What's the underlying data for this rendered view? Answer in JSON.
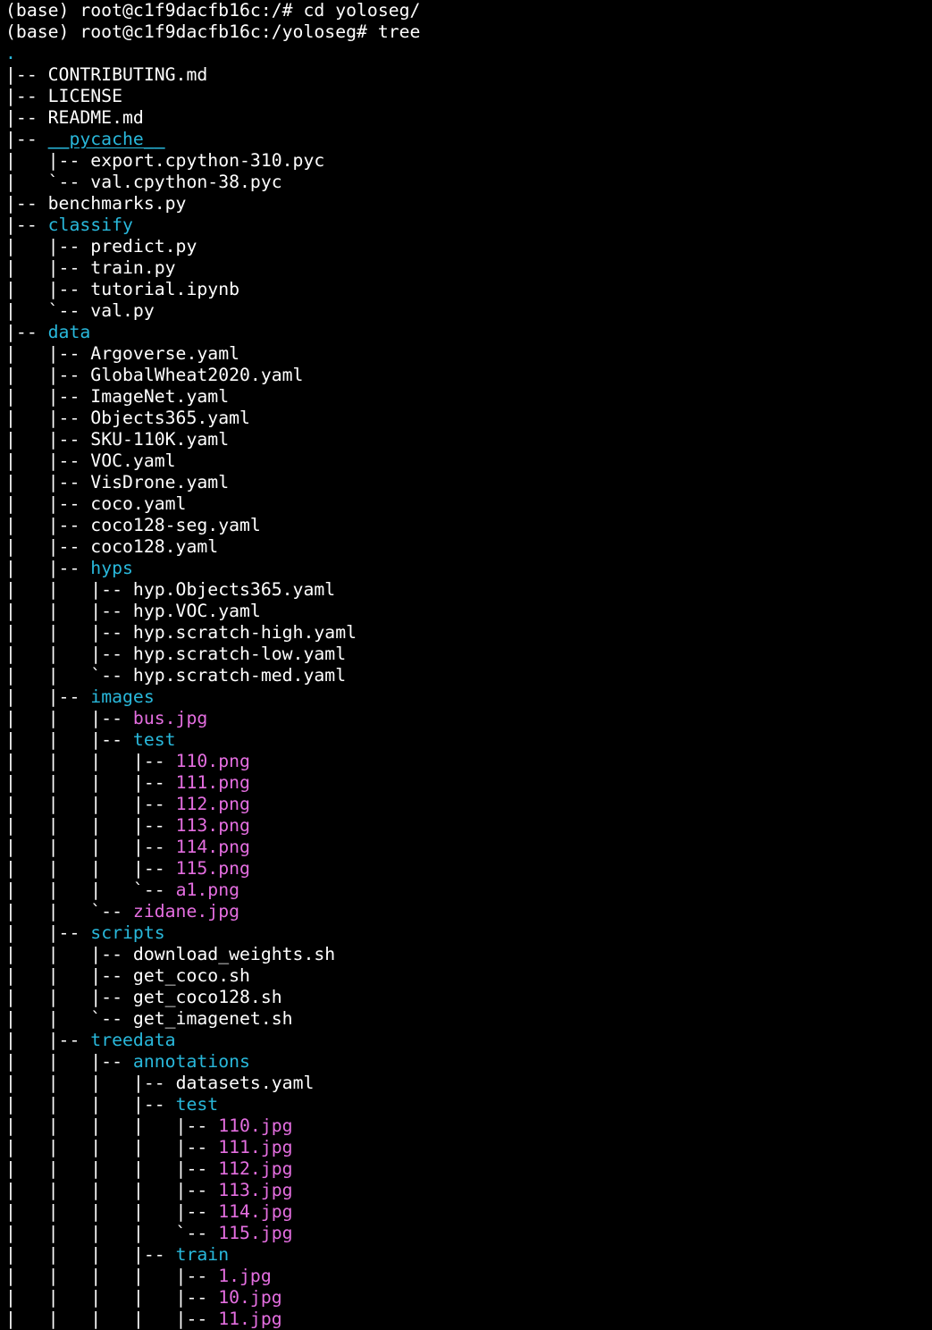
{
  "terminal": {
    "colors": {
      "background": "#000000",
      "text": "#ffffff",
      "directory": "#29b8db",
      "image_file": "#e46ee0"
    },
    "lines": [
      {
        "kind": "prompt",
        "segments": [
          {
            "t": "(base) root@c1f9dacfb16c:/# cd yoloseg/",
            "s": "plain"
          }
        ]
      },
      {
        "kind": "prompt",
        "segments": [
          {
            "t": "(base) root@c1f9dacfb16c:/yoloseg# tree",
            "s": "plain"
          }
        ]
      },
      {
        "kind": "tree",
        "segments": [
          {
            "t": ".",
            "s": "dot"
          }
        ]
      },
      {
        "kind": "tree",
        "segments": [
          {
            "t": "|-- ",
            "s": "plain"
          },
          {
            "t": "CONTRIBUTING.md",
            "s": "plain"
          }
        ]
      },
      {
        "kind": "tree",
        "segments": [
          {
            "t": "|-- ",
            "s": "plain"
          },
          {
            "t": "LICENSE",
            "s": "plain"
          }
        ]
      },
      {
        "kind": "tree",
        "segments": [
          {
            "t": "|-- ",
            "s": "plain"
          },
          {
            "t": "README.md",
            "s": "plain"
          }
        ]
      },
      {
        "kind": "tree",
        "segments": [
          {
            "t": "|-- ",
            "s": "plain"
          },
          {
            "t": "__pycache__",
            "s": "under"
          }
        ]
      },
      {
        "kind": "tree",
        "segments": [
          {
            "t": "|   |-- ",
            "s": "plain"
          },
          {
            "t": "export.cpython-310.pyc",
            "s": "plain"
          }
        ]
      },
      {
        "kind": "tree",
        "segments": [
          {
            "t": "|   `-- ",
            "s": "plain"
          },
          {
            "t": "val.cpython-38.pyc",
            "s": "plain"
          }
        ]
      },
      {
        "kind": "tree",
        "segments": [
          {
            "t": "|-- ",
            "s": "plain"
          },
          {
            "t": "benchmarks.py",
            "s": "plain"
          }
        ]
      },
      {
        "kind": "tree",
        "segments": [
          {
            "t": "|-- ",
            "s": "plain"
          },
          {
            "t": "classify",
            "s": "dir"
          }
        ]
      },
      {
        "kind": "tree",
        "segments": [
          {
            "t": "|   |-- ",
            "s": "plain"
          },
          {
            "t": "predict.py",
            "s": "plain"
          }
        ]
      },
      {
        "kind": "tree",
        "segments": [
          {
            "t": "|   |-- ",
            "s": "plain"
          },
          {
            "t": "train.py",
            "s": "plain"
          }
        ]
      },
      {
        "kind": "tree",
        "segments": [
          {
            "t": "|   |-- ",
            "s": "plain"
          },
          {
            "t": "tutorial.ipynb",
            "s": "plain"
          }
        ]
      },
      {
        "kind": "tree",
        "segments": [
          {
            "t": "|   `-- ",
            "s": "plain"
          },
          {
            "t": "val.py",
            "s": "plain"
          }
        ]
      },
      {
        "kind": "tree",
        "segments": [
          {
            "t": "|-- ",
            "s": "plain"
          },
          {
            "t": "data",
            "s": "dir"
          }
        ]
      },
      {
        "kind": "tree",
        "segments": [
          {
            "t": "|   |-- ",
            "s": "plain"
          },
          {
            "t": "Argoverse.yaml",
            "s": "plain"
          }
        ]
      },
      {
        "kind": "tree",
        "segments": [
          {
            "t": "|   |-- ",
            "s": "plain"
          },
          {
            "t": "GlobalWheat2020.yaml",
            "s": "plain"
          }
        ]
      },
      {
        "kind": "tree",
        "segments": [
          {
            "t": "|   |-- ",
            "s": "plain"
          },
          {
            "t": "ImageNet.yaml",
            "s": "plain"
          }
        ]
      },
      {
        "kind": "tree",
        "segments": [
          {
            "t": "|   |-- ",
            "s": "plain"
          },
          {
            "t": "Objects365.yaml",
            "s": "plain"
          }
        ]
      },
      {
        "kind": "tree",
        "segments": [
          {
            "t": "|   |-- ",
            "s": "plain"
          },
          {
            "t": "SKU-110K.yaml",
            "s": "plain"
          }
        ]
      },
      {
        "kind": "tree",
        "segments": [
          {
            "t": "|   |-- ",
            "s": "plain"
          },
          {
            "t": "VOC.yaml",
            "s": "plain"
          }
        ]
      },
      {
        "kind": "tree",
        "segments": [
          {
            "t": "|   |-- ",
            "s": "plain"
          },
          {
            "t": "VisDrone.yaml",
            "s": "plain"
          }
        ]
      },
      {
        "kind": "tree",
        "segments": [
          {
            "t": "|   |-- ",
            "s": "plain"
          },
          {
            "t": "coco.yaml",
            "s": "plain"
          }
        ]
      },
      {
        "kind": "tree",
        "segments": [
          {
            "t": "|   |-- ",
            "s": "plain"
          },
          {
            "t": "coco128-seg.yaml",
            "s": "plain"
          }
        ]
      },
      {
        "kind": "tree",
        "segments": [
          {
            "t": "|   |-- ",
            "s": "plain"
          },
          {
            "t": "coco128.yaml",
            "s": "plain"
          }
        ]
      },
      {
        "kind": "tree",
        "segments": [
          {
            "t": "|   |-- ",
            "s": "plain"
          },
          {
            "t": "hyps",
            "s": "dir"
          }
        ]
      },
      {
        "kind": "tree",
        "segments": [
          {
            "t": "|   |   |-- ",
            "s": "plain"
          },
          {
            "t": "hyp.Objects365.yaml",
            "s": "plain"
          }
        ]
      },
      {
        "kind": "tree",
        "segments": [
          {
            "t": "|   |   |-- ",
            "s": "plain"
          },
          {
            "t": "hyp.VOC.yaml",
            "s": "plain"
          }
        ]
      },
      {
        "kind": "tree",
        "segments": [
          {
            "t": "|   |   |-- ",
            "s": "plain"
          },
          {
            "t": "hyp.scratch-high.yaml",
            "s": "plain"
          }
        ]
      },
      {
        "kind": "tree",
        "segments": [
          {
            "t": "|   |   |-- ",
            "s": "plain"
          },
          {
            "t": "hyp.scratch-low.yaml",
            "s": "plain"
          }
        ]
      },
      {
        "kind": "tree",
        "segments": [
          {
            "t": "|   |   `-- ",
            "s": "plain"
          },
          {
            "t": "hyp.scratch-med.yaml",
            "s": "plain"
          }
        ]
      },
      {
        "kind": "tree",
        "segments": [
          {
            "t": "|   |-- ",
            "s": "plain"
          },
          {
            "t": "images",
            "s": "dir"
          }
        ]
      },
      {
        "kind": "tree",
        "segments": [
          {
            "t": "|   |   |-- ",
            "s": "plain"
          },
          {
            "t": "bus.jpg",
            "s": "img"
          }
        ]
      },
      {
        "kind": "tree",
        "segments": [
          {
            "t": "|   |   |-- ",
            "s": "plain"
          },
          {
            "t": "test",
            "s": "dir"
          }
        ]
      },
      {
        "kind": "tree",
        "segments": [
          {
            "t": "|   |   |   |-- ",
            "s": "plain"
          },
          {
            "t": "110.png",
            "s": "img"
          }
        ]
      },
      {
        "kind": "tree",
        "segments": [
          {
            "t": "|   |   |   |-- ",
            "s": "plain"
          },
          {
            "t": "111.png",
            "s": "img"
          }
        ]
      },
      {
        "kind": "tree",
        "segments": [
          {
            "t": "|   |   |   |-- ",
            "s": "plain"
          },
          {
            "t": "112.png",
            "s": "img"
          }
        ]
      },
      {
        "kind": "tree",
        "segments": [
          {
            "t": "|   |   |   |-- ",
            "s": "plain"
          },
          {
            "t": "113.png",
            "s": "img"
          }
        ]
      },
      {
        "kind": "tree",
        "segments": [
          {
            "t": "|   |   |   |-- ",
            "s": "plain"
          },
          {
            "t": "114.png",
            "s": "img"
          }
        ]
      },
      {
        "kind": "tree",
        "segments": [
          {
            "t": "|   |   |   |-- ",
            "s": "plain"
          },
          {
            "t": "115.png",
            "s": "img"
          }
        ]
      },
      {
        "kind": "tree",
        "segments": [
          {
            "t": "|   |   |   `-- ",
            "s": "plain"
          },
          {
            "t": "a1.png",
            "s": "img"
          }
        ]
      },
      {
        "kind": "tree",
        "segments": [
          {
            "t": "|   |   `-- ",
            "s": "plain"
          },
          {
            "t": "zidane.jpg",
            "s": "img"
          }
        ]
      },
      {
        "kind": "tree",
        "segments": [
          {
            "t": "|   |-- ",
            "s": "plain"
          },
          {
            "t": "scripts",
            "s": "dir"
          }
        ]
      },
      {
        "kind": "tree",
        "segments": [
          {
            "t": "|   |   |-- ",
            "s": "plain"
          },
          {
            "t": "download_weights.sh",
            "s": "plain"
          }
        ]
      },
      {
        "kind": "tree",
        "segments": [
          {
            "t": "|   |   |-- ",
            "s": "plain"
          },
          {
            "t": "get_coco.sh",
            "s": "plain"
          }
        ]
      },
      {
        "kind": "tree",
        "segments": [
          {
            "t": "|   |   |-- ",
            "s": "plain"
          },
          {
            "t": "get_coco128.sh",
            "s": "plain"
          }
        ]
      },
      {
        "kind": "tree",
        "segments": [
          {
            "t": "|   |   `-- ",
            "s": "plain"
          },
          {
            "t": "get_imagenet.sh",
            "s": "plain"
          }
        ]
      },
      {
        "kind": "tree",
        "segments": [
          {
            "t": "|   |-- ",
            "s": "plain"
          },
          {
            "t": "treedata",
            "s": "dir"
          }
        ]
      },
      {
        "kind": "tree",
        "segments": [
          {
            "t": "|   |   |-- ",
            "s": "plain"
          },
          {
            "t": "annotations",
            "s": "dir"
          }
        ]
      },
      {
        "kind": "tree",
        "segments": [
          {
            "t": "|   |   |   |-- ",
            "s": "plain"
          },
          {
            "t": "datasets.yaml",
            "s": "plain"
          }
        ]
      },
      {
        "kind": "tree",
        "segments": [
          {
            "t": "|   |   |   |-- ",
            "s": "plain"
          },
          {
            "t": "test",
            "s": "dir"
          }
        ]
      },
      {
        "kind": "tree",
        "segments": [
          {
            "t": "|   |   |   |   |-- ",
            "s": "plain"
          },
          {
            "t": "110.jpg",
            "s": "img"
          }
        ]
      },
      {
        "kind": "tree",
        "segments": [
          {
            "t": "|   |   |   |   |-- ",
            "s": "plain"
          },
          {
            "t": "111.jpg",
            "s": "img"
          }
        ]
      },
      {
        "kind": "tree",
        "segments": [
          {
            "t": "|   |   |   |   |-- ",
            "s": "plain"
          },
          {
            "t": "112.jpg",
            "s": "img"
          }
        ]
      },
      {
        "kind": "tree",
        "segments": [
          {
            "t": "|   |   |   |   |-- ",
            "s": "plain"
          },
          {
            "t": "113.jpg",
            "s": "img"
          }
        ]
      },
      {
        "kind": "tree",
        "segments": [
          {
            "t": "|   |   |   |   |-- ",
            "s": "plain"
          },
          {
            "t": "114.jpg",
            "s": "img"
          }
        ]
      },
      {
        "kind": "tree",
        "segments": [
          {
            "t": "|   |   |   |   `-- ",
            "s": "plain"
          },
          {
            "t": "115.jpg",
            "s": "img"
          }
        ]
      },
      {
        "kind": "tree",
        "segments": [
          {
            "t": "|   |   |   |-- ",
            "s": "plain"
          },
          {
            "t": "train",
            "s": "dir"
          }
        ]
      },
      {
        "kind": "tree",
        "segments": [
          {
            "t": "|   |   |   |   |-- ",
            "s": "plain"
          },
          {
            "t": "1.jpg",
            "s": "img"
          }
        ]
      },
      {
        "kind": "tree",
        "segments": [
          {
            "t": "|   |   |   |   |-- ",
            "s": "plain"
          },
          {
            "t": "10.jpg",
            "s": "img"
          }
        ]
      },
      {
        "kind": "tree",
        "segments": [
          {
            "t": "|   |   |   |   |-- ",
            "s": "plain"
          },
          {
            "t": "11.jpg",
            "s": "img"
          }
        ]
      }
    ]
  }
}
